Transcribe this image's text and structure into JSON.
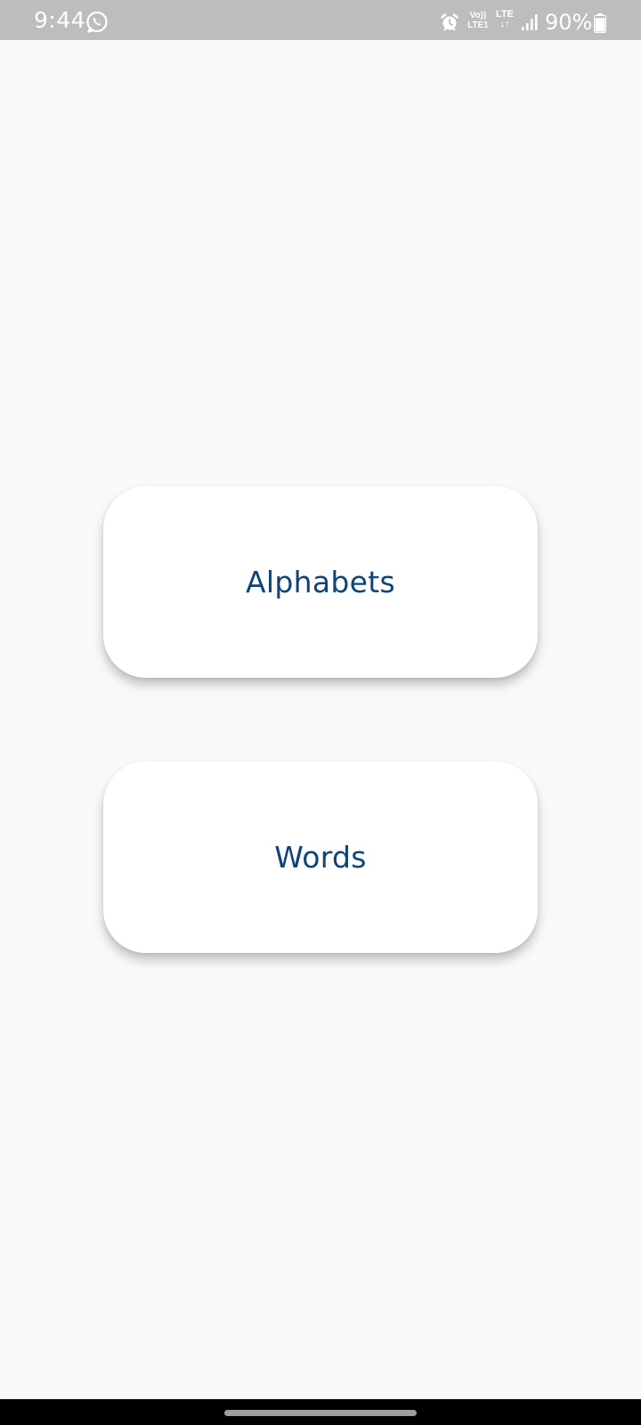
{
  "status_bar": {
    "time": "9:44",
    "volte_top": "Vo))",
    "volte_bottom": "LTE1",
    "lte_top": "LTE",
    "lte_bottom": "↓↑",
    "battery_percent": "90%",
    "battery_level": 0.9,
    "icons": [
      "whatsapp-icon",
      "alarm-icon",
      "volte-icon",
      "lte-icon",
      "signal-icon",
      "battery-icon"
    ]
  },
  "menu": {
    "alphabets_label": "Alphabets",
    "words_label": "Words"
  },
  "colors": {
    "background": "#f9f9f9",
    "status_bar": "#bdbdbd",
    "card": "#ffffff",
    "label_text": "#0e4477",
    "nav_bar": "#000000"
  }
}
